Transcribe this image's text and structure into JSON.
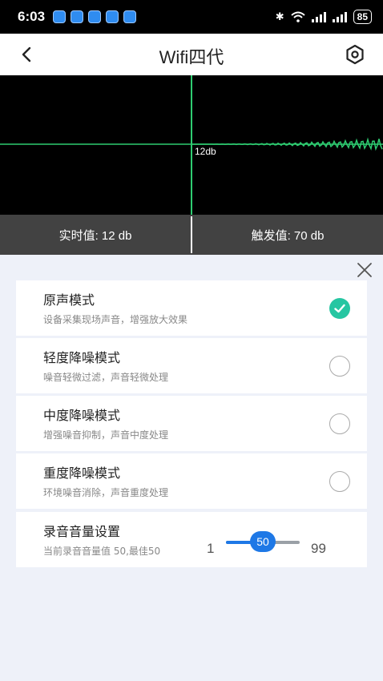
{
  "status_bar": {
    "time": "6:03",
    "battery": "85"
  },
  "header": {
    "title": "Wifi四代"
  },
  "scope": {
    "level_label": "12db"
  },
  "stats": {
    "realtime": "实时值: 12 db",
    "trigger": "触发值: 70 db"
  },
  "modes": [
    {
      "title": "原声模式",
      "desc": "设备采集现场声音，增强放大效果",
      "selected": true
    },
    {
      "title": "轻度降噪模式",
      "desc": "噪音轻微过滤，声音轻微处理",
      "selected": false
    },
    {
      "title": "中度降噪模式",
      "desc": "增强噪音抑制，声音中度处理",
      "selected": false
    },
    {
      "title": "重度降噪模式",
      "desc": "环境噪音消除，声音重度处理",
      "selected": false
    }
  ],
  "volume": {
    "title": "录音音量设置",
    "desc": "当前录音音量值 50,最佳50",
    "min": "1",
    "max": "99",
    "value": "50"
  },
  "colors": {
    "accent_blue": "#1e78e6",
    "check_green": "#26c6a2",
    "scope_green": "#2ecc71"
  }
}
